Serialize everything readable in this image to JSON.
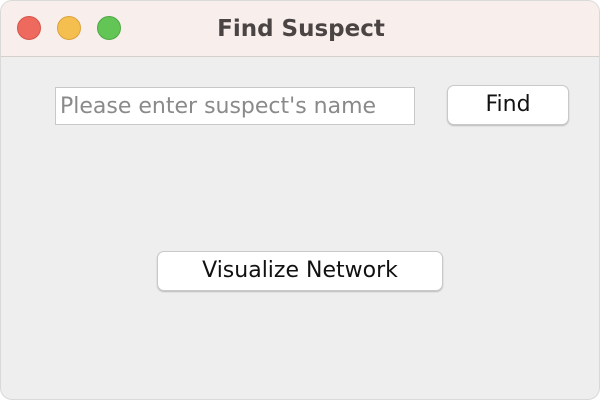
{
  "window": {
    "title": "Find Suspect",
    "controls": {
      "close_color": "#ee6a5f",
      "minimize_color": "#f5bf4f",
      "zoom_color": "#62c555"
    }
  },
  "search": {
    "value": "",
    "placeholder": "Please enter suspect's name"
  },
  "buttons": {
    "find_label": "Find",
    "visualize_label": "Visualize Network"
  }
}
